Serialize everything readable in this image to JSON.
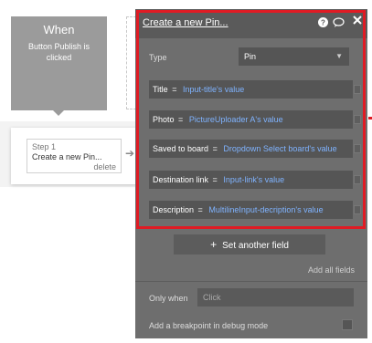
{
  "event": {
    "title": "When",
    "description": "Button Publish is clicked"
  },
  "step": {
    "label": "Step 1",
    "action": "Create a new Pin...",
    "delete_label": "delete"
  },
  "editor": {
    "title": "Create a new Pin...",
    "icons": [
      "help-icon",
      "comment-icon",
      "close-icon"
    ],
    "type_label": "Type",
    "type_value": "Pin",
    "fields": [
      {
        "name": "Title",
        "value": "Input-title's value"
      },
      {
        "name": "Photo",
        "value": "PictureUploader A's value"
      },
      {
        "name": "Saved to board",
        "value": "Dropdown Select board's value"
      },
      {
        "name": "Destination link",
        "value": "Input-link's value"
      },
      {
        "name": "Description",
        "value": "MultilineInput-decription's value"
      }
    ],
    "set_another_field": "Set another field",
    "add_all_fields": "Add all fields",
    "only_when_label": "Only when",
    "only_when_placeholder": "Click",
    "breakpoint_label": "Add a breakpoint in debug mode",
    "eq": "="
  },
  "colors": {
    "highlight": "#e01b24",
    "expression": "#7fb3ff",
    "panel": "#6e6e6e"
  }
}
